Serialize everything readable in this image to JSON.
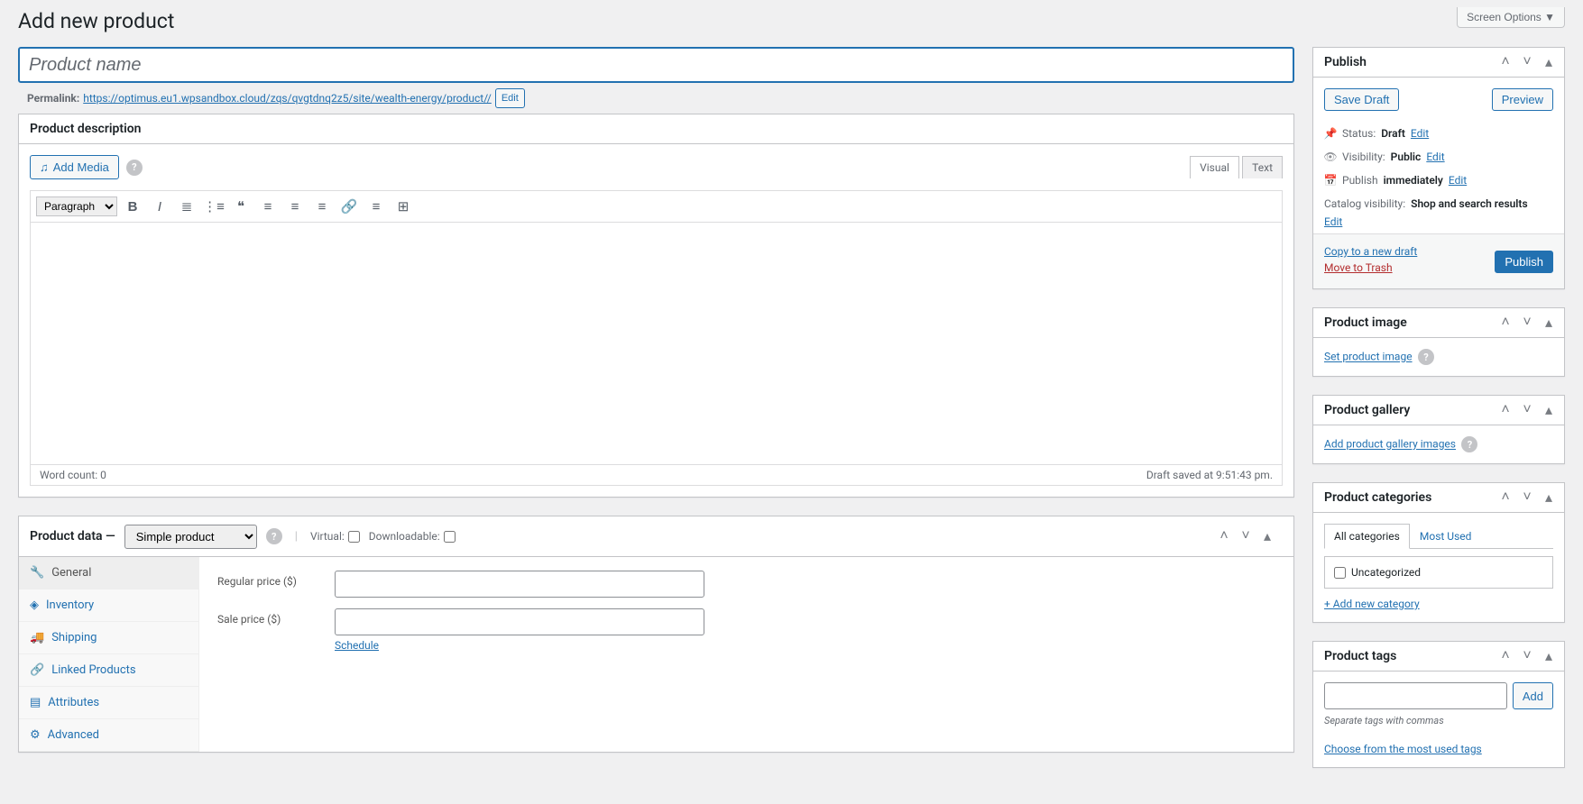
{
  "screenOptions": "Screen Options ▼",
  "pageTitle": "Add new product",
  "titlePlaceholder": "Product name",
  "permalink": {
    "label": "Permalink:",
    "url": "https://optimus.eu1.wpsandbox.cloud/zqs/qvgtdnq2z5/site/wealth-energy/product//",
    "editBtn": "Edit"
  },
  "description": {
    "panelTitle": "Product description",
    "addMedia": "Add Media",
    "tabs": {
      "visual": "Visual",
      "text": "Text"
    },
    "paragraph": "Paragraph",
    "wordCount": "Word count: 0",
    "draftSaved": "Draft saved at 9:51:43 pm."
  },
  "productData": {
    "label": "Product data —",
    "type": "Simple product",
    "virtual": "Virtual:",
    "downloadable": "Downloadable:",
    "tabs": {
      "general": "General",
      "inventory": "Inventory",
      "shipping": "Shipping",
      "linked": "Linked Products",
      "attributes": "Attributes",
      "advanced": "Advanced"
    },
    "regularPrice": "Regular price ($)",
    "salePrice": "Sale price ($)",
    "schedule": "Schedule"
  },
  "publish": {
    "title": "Publish",
    "saveDraft": "Save Draft",
    "preview": "Preview",
    "statusLabel": "Status:",
    "statusValue": "Draft",
    "visibilityLabel": "Visibility:",
    "visibilityValue": "Public",
    "publishLabel": "Publish",
    "publishValue": "immediately",
    "catalogLabel": "Catalog visibility:",
    "catalogValue": "Shop and search results",
    "edit": "Edit",
    "copy": "Copy to a new draft",
    "trash": "Move to Trash",
    "publishBtn": "Publish"
  },
  "productImage": {
    "title": "Product image",
    "link": "Set product image"
  },
  "productGallery": {
    "title": "Product gallery",
    "link": "Add product gallery images"
  },
  "productCategories": {
    "title": "Product categories",
    "allTab": "All categories",
    "mostTab": "Most Used",
    "uncategorized": "Uncategorized",
    "addNew": "+ Add new category"
  },
  "productTags": {
    "title": "Product tags",
    "add": "Add",
    "hint": "Separate tags with commas",
    "choose": "Choose from the most used tags"
  }
}
